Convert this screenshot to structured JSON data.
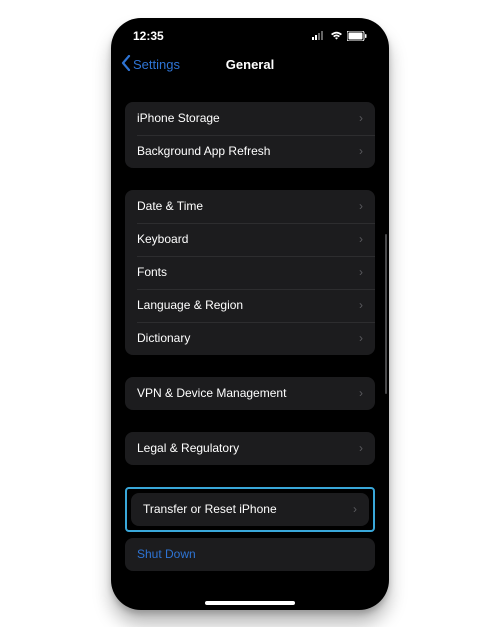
{
  "status": {
    "time": "12:35"
  },
  "nav": {
    "back_label": "Settings",
    "title": "General"
  },
  "sections": [
    {
      "items": [
        {
          "label": "iPhone Storage"
        },
        {
          "label": "Background App Refresh"
        }
      ]
    },
    {
      "items": [
        {
          "label": "Date & Time"
        },
        {
          "label": "Keyboard"
        },
        {
          "label": "Fonts"
        },
        {
          "label": "Language & Region"
        },
        {
          "label": "Dictionary"
        }
      ]
    },
    {
      "items": [
        {
          "label": "VPN & Device Management"
        }
      ]
    },
    {
      "items": [
        {
          "label": "Legal & Regulatory"
        }
      ]
    }
  ],
  "highlighted": {
    "label": "Transfer or Reset iPhone"
  },
  "shutdown": {
    "label": "Shut Down"
  }
}
